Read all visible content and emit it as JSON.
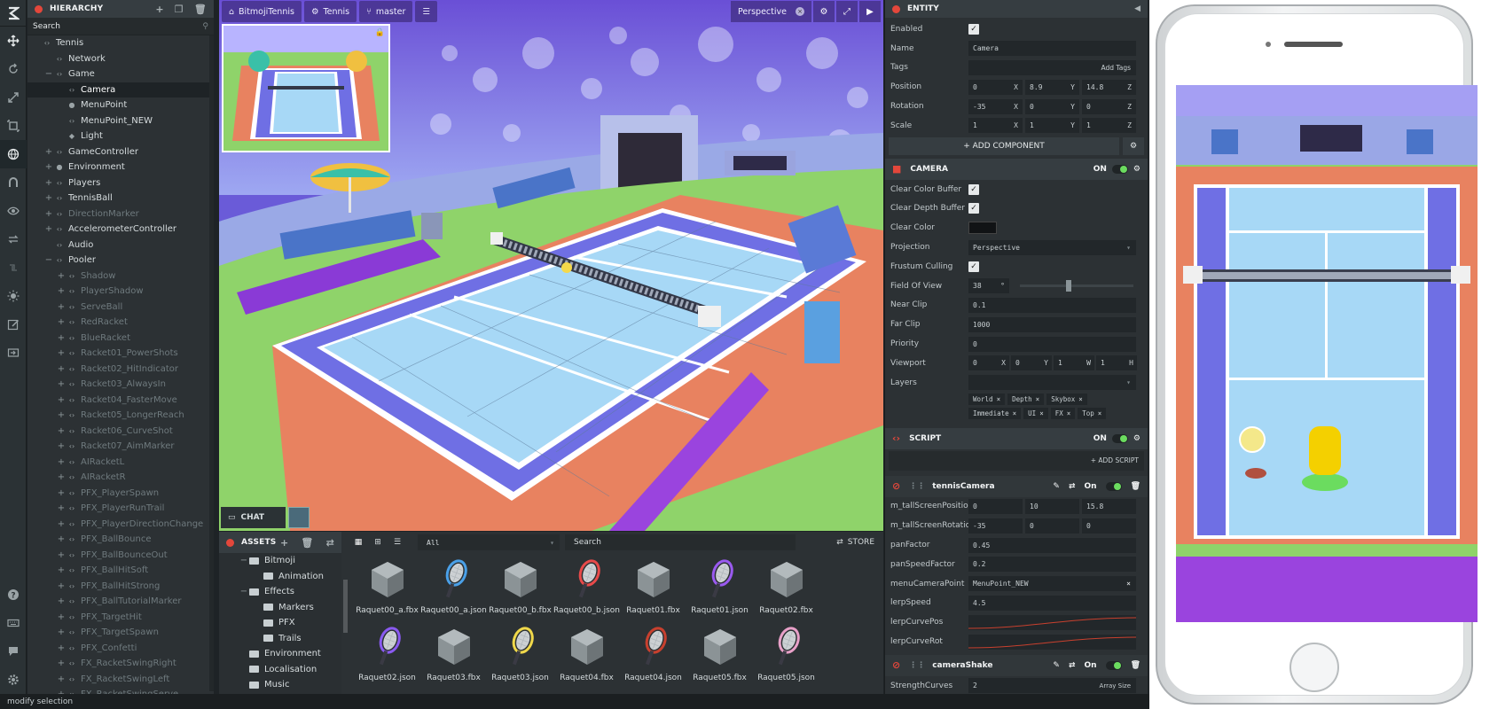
{
  "hierarchy": {
    "title": "HIERARCHY",
    "search_placeholder": "Search",
    "items": [
      {
        "label": "Tennis"
      },
      {
        "label": "Network"
      },
      {
        "label": "Game"
      },
      {
        "label": "Camera"
      },
      {
        "label": "MenuPoint"
      },
      {
        "label": "MenuPoint_NEW"
      },
      {
        "label": "Light"
      },
      {
        "label": "GameController"
      },
      {
        "label": "Environment"
      },
      {
        "label": "Players"
      },
      {
        "label": "TennisBall"
      },
      {
        "label": "DirectionMarker"
      },
      {
        "label": "AccelerometerController"
      },
      {
        "label": "Audio"
      },
      {
        "label": "Pooler"
      },
      {
        "label": "Shadow"
      },
      {
        "label": "PlayerShadow"
      },
      {
        "label": "ServeBall"
      },
      {
        "label": "RedRacket"
      },
      {
        "label": "BlueRacket"
      },
      {
        "label": "Racket01_PowerShots"
      },
      {
        "label": "Racket02_HitIndicator"
      },
      {
        "label": "Racket03_AlwaysIn"
      },
      {
        "label": "Racket04_FasterMove"
      },
      {
        "label": "Racket05_LongerReach"
      },
      {
        "label": "Racket06_CurveShot"
      },
      {
        "label": "Racket07_AimMarker"
      },
      {
        "label": "AIRacketL"
      },
      {
        "label": "AIRacketR"
      },
      {
        "label": "PFX_PlayerSpawn"
      },
      {
        "label": "PFX_PlayerRunTrail"
      },
      {
        "label": "PFX_PlayerDirectionChange"
      },
      {
        "label": "PFX_BallBounce"
      },
      {
        "label": "PFX_BallBounceOut"
      },
      {
        "label": "PFX_BallHitSoft"
      },
      {
        "label": "PFX_BallHitStrong"
      },
      {
        "label": "PFX_BallTutorialMarker"
      },
      {
        "label": "PFX_TargetHit"
      },
      {
        "label": "PFX_TargetSpawn"
      },
      {
        "label": "PFX_Confetti"
      },
      {
        "label": "FX_RacketSwingRight"
      },
      {
        "label": "FX_RacketSwingLeft"
      },
      {
        "label": "FX_RacketSwingServe"
      }
    ]
  },
  "viewport": {
    "project": "BitmojiTennis",
    "scene": "Tennis",
    "branch": "master",
    "camera_mode": "Perspective",
    "chat": "CHAT"
  },
  "assets": {
    "title": "ASSETS",
    "filter": "All",
    "search_placeholder": "Search",
    "store": "STORE",
    "folders": [
      {
        "label": "Bitmoji"
      },
      {
        "label": "Animation"
      },
      {
        "label": "Effects"
      },
      {
        "label": "Markers"
      },
      {
        "label": "PFX"
      },
      {
        "label": "Trails"
      },
      {
        "label": "Environment"
      },
      {
        "label": "Localisation"
      },
      {
        "label": "Music"
      }
    ],
    "files": [
      {
        "name": "Raquet00_a.fbx",
        "kind": "cube"
      },
      {
        "name": "Raquet00_a.json",
        "kind": "racket",
        "color": "#4aa0e8"
      },
      {
        "name": "Raquet00_b.fbx",
        "kind": "cube"
      },
      {
        "name": "Raquet00_b.json",
        "kind": "racket",
        "color": "#e84a4a"
      },
      {
        "name": "Raquet01.fbx",
        "kind": "cube"
      },
      {
        "name": "Raquet01.json",
        "kind": "racket",
        "color": "#9a5af0"
      },
      {
        "name": "Raquet02.fbx",
        "kind": "cube"
      },
      {
        "name": "Raquet02.json",
        "kind": "racket",
        "color": "#8a5af0"
      },
      {
        "name": "Raquet03.fbx",
        "kind": "cube"
      },
      {
        "name": "Raquet03.json",
        "kind": "racket",
        "color": "#f0d84a"
      },
      {
        "name": "Raquet04.fbx",
        "kind": "cube"
      },
      {
        "name": "Raquet04.json",
        "kind": "racket",
        "color": "#c8402e"
      },
      {
        "name": "Raquet05.fbx",
        "kind": "cube"
      },
      {
        "name": "Raquet05.json",
        "kind": "racket",
        "color": "#e8a0c8"
      }
    ]
  },
  "entity": {
    "title": "ENTITY",
    "enabled_label": "Enabled",
    "name_label": "Name",
    "name_value": "Camera",
    "tags_label": "Tags",
    "add_tags": "Add Tags",
    "position_label": "Position",
    "position": [
      "0",
      "8.9",
      "14.8"
    ],
    "rotation_label": "Rotation",
    "rotation": [
      "-35",
      "0",
      "0"
    ],
    "scale_label": "Scale",
    "scale": [
      "1",
      "1",
      "1"
    ],
    "axes": [
      "X",
      "Y",
      "Z"
    ],
    "add_component": "ADD COMPONENT"
  },
  "camera": {
    "title": "CAMERA",
    "on": "ON",
    "clear_color_buffer": "Clear Color Buffer",
    "clear_depth_buffer": "Clear Depth Buffer",
    "clear_color": "Clear Color",
    "projection_label": "Projection",
    "projection": "Perspective",
    "frustum_culling": "Frustum Culling",
    "fov_label": "Field Of View",
    "fov": "38",
    "fov_unit": "°",
    "near_label": "Near Clip",
    "near": "0.1",
    "far_label": "Far Clip",
    "far": "1000",
    "priority_label": "Priority",
    "priority": "0",
    "viewport_label": "Viewport",
    "viewport_vals": [
      "0",
      "0",
      "1",
      "1"
    ],
    "viewport_axes": [
      "X",
      "Y",
      "W",
      "H"
    ],
    "layers_label": "Layers",
    "layers_row1": [
      "World",
      "Depth",
      "Skybox"
    ],
    "layers_row2": [
      "Immediate",
      "UI",
      "FX",
      "Top"
    ]
  },
  "script": {
    "title": "SCRIPT",
    "on": "ON",
    "add_script": "+ ADD SCRIPT",
    "tennisCamera": {
      "name": "tennisCamera",
      "on": "On",
      "tallScreenPosition_label": "m_tallScreenPosition",
      "tallScreenPosition": [
        "0",
        "10",
        "15.8"
      ],
      "tallScreenRotation_label": "m_tallScreenRotation",
      "tallScreenRotation": [
        "-35",
        "0",
        "0"
      ],
      "panFactor_label": "panFactor",
      "panFactor": "0.45",
      "panSpeedFactor_label": "panSpeedFactor",
      "panSpeedFactor": "0.2",
      "menuCameraPoint_label": "menuCameraPoint",
      "menuCameraPoint": "MenuPoint_NEW",
      "lerpSpeed_label": "lerpSpeed",
      "lerpSpeed": "4.5",
      "lerpCurvePos_label": "lerpCurvePos",
      "lerpCurveRot_label": "lerpCurveRot"
    },
    "cameraShake": {
      "name": "cameraShake",
      "on": "On",
      "strength_label": "StrengthCurves",
      "strength": "2",
      "array_size": "Array Size"
    }
  },
  "status": {
    "text": "modify selection"
  },
  "colors": {
    "accent": "#e3473b",
    "toggle_on": "#6bdc5f",
    "panel": "#2c3134"
  }
}
